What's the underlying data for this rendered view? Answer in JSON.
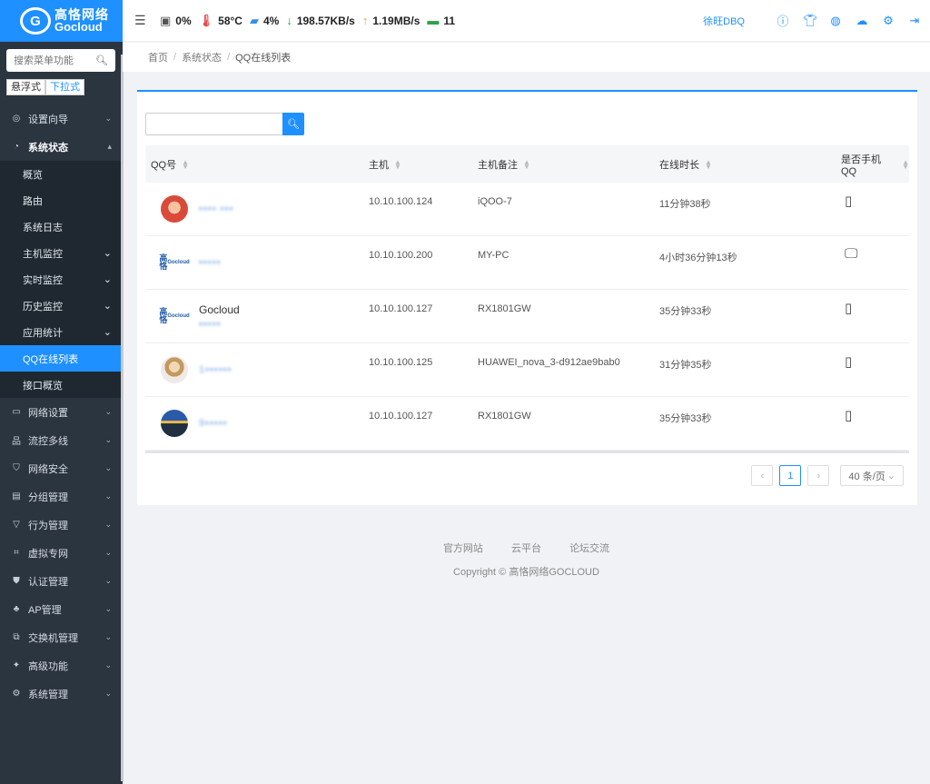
{
  "brand": {
    "mark": "G",
    "name_cn": "高恪网络",
    "name_en": "Gocloud"
  },
  "sidebar": {
    "search_placeholder": "搜索菜单功能",
    "modes": [
      "悬浮式",
      "下拉式"
    ],
    "items_top": [
      {
        "label": "设置向导",
        "icon": "compass-icon"
      },
      {
        "label": "系统状态",
        "icon": "dashboard-icon"
      }
    ],
    "submenu": [
      {
        "label": "概览"
      },
      {
        "label": "路由"
      },
      {
        "label": "系统日志"
      },
      {
        "label": "主机监控"
      },
      {
        "label": "实时监控"
      },
      {
        "label": "历史监控"
      },
      {
        "label": "应用统计"
      },
      {
        "label": "QQ在线列表"
      },
      {
        "label": "接口概览"
      }
    ],
    "items_bottom": [
      {
        "label": "网络设置",
        "icon": "monitor-icon"
      },
      {
        "label": "流控多线",
        "icon": "network-icon"
      },
      {
        "label": "网络安全",
        "icon": "shield-icon"
      },
      {
        "label": "分组管理",
        "icon": "group-icon"
      },
      {
        "label": "行为管理",
        "icon": "filter-icon"
      },
      {
        "label": "虚拟专网",
        "icon": "vpn-icon"
      },
      {
        "label": "认证管理",
        "icon": "auth-shield-icon"
      },
      {
        "label": "AP管理",
        "icon": "ap-icon"
      },
      {
        "label": "交换机管理",
        "icon": "switch-icon"
      },
      {
        "label": "高级功能",
        "icon": "pin-icon"
      },
      {
        "label": "系统管理",
        "icon": "gear-icon"
      }
    ]
  },
  "topbar": {
    "cpu": "0%",
    "temp": "58°C",
    "mem": "4%",
    "down": "198.57KB/s",
    "up": "1.19MB/s",
    "hosts": "11",
    "user": "徐旺DBQ"
  },
  "breadcrumb": [
    "首页",
    "系统状态",
    "QQ在线列表"
  ],
  "table": {
    "columns": [
      "QQ号",
      "主机",
      "主机备注",
      "在线时长",
      "是否手机QQ"
    ],
    "rows": [
      {
        "name": "",
        "qq": "▪▪▪▪ ▪▪▪",
        "host": "10.10.100.124",
        "note": "iQOO-7",
        "duration": "11分钟38秒",
        "device": "mobile"
      },
      {
        "name": "",
        "qq": "▪▪▪▪▪",
        "host": "10.10.100.200",
        "note": "MY-PC",
        "duration": "4小时36分钟13秒",
        "device": "pc"
      },
      {
        "name": "Gocloud",
        "qq": "▪▪▪▪▪",
        "host": "10.10.100.127",
        "note": "RX1801GW",
        "duration": "35分钟33秒",
        "device": "mobile"
      },
      {
        "name": "",
        "qq": "1▪▪▪▪▪▪",
        "host": "10.10.100.125",
        "note": "HUAWEI_nova_3-d912ae9bab0",
        "duration": "31分钟35秒",
        "device": "mobile"
      },
      {
        "name": "",
        "qq": "9▪▪▪▪▪",
        "host": "10.10.100.127",
        "note": "RX1801GW",
        "duration": "35分钟33秒",
        "device": "mobile"
      }
    ]
  },
  "pagination": {
    "current": "1",
    "page_size": "40 条/页"
  },
  "footer": {
    "links": [
      "官方网站",
      "云平台",
      "论坛交流"
    ],
    "copyright": "Copyright © 高恪网络GOCLOUD"
  }
}
